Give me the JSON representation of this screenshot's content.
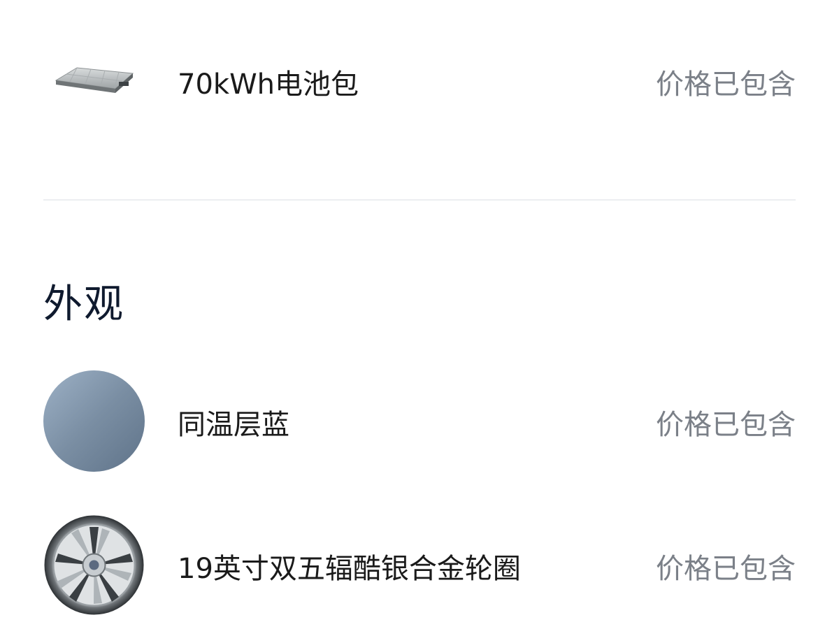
{
  "items": [
    {
      "name": "70kWh电池包",
      "price": "价格已包含",
      "icon": "battery-pack-icon"
    }
  ],
  "section": {
    "title": "外观"
  },
  "exterior": [
    {
      "name": "同温层蓝",
      "price": "价格已包含",
      "icon": "color-swatch-icon",
      "color": "#7a8ea3"
    },
    {
      "name": "19英寸双五辐酷银合金轮圈",
      "price": "价格已包含",
      "icon": "alloy-wheel-icon"
    }
  ]
}
